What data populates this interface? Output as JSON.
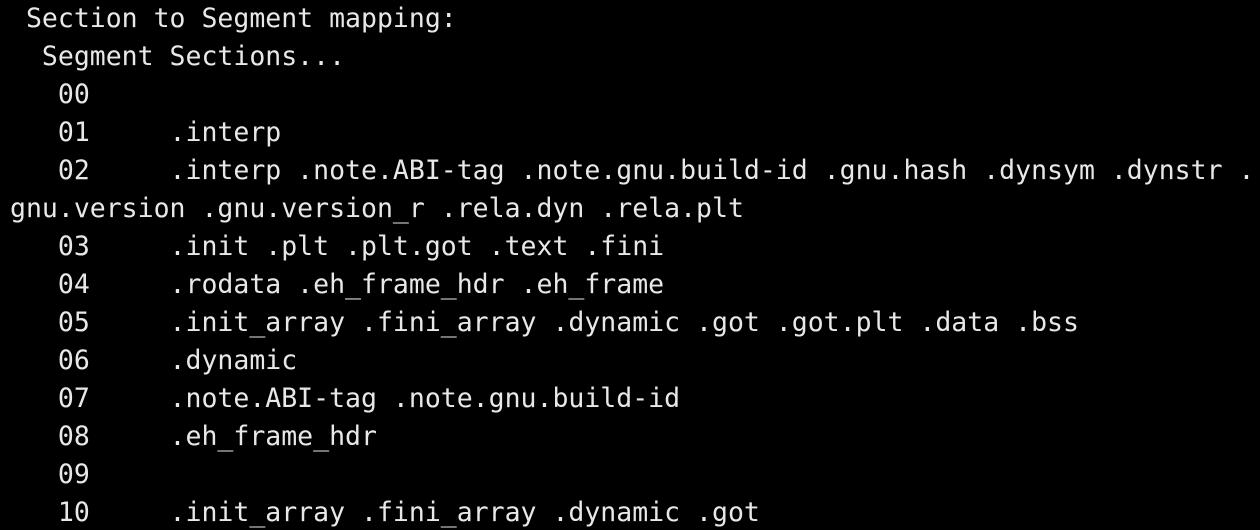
{
  "colors": {
    "background": "#000000",
    "text": "#e8e8e8"
  },
  "terminal": {
    "lines": [
      " Section to Segment mapping:",
      "  Segment Sections...",
      "   00     ",
      "   01     .interp ",
      "   02     .interp .note.ABI-tag .note.gnu.build-id .gnu.hash .dynsym .dynstr .",
      "gnu.version .gnu.version_r .rela.dyn .rela.plt ",
      "   03     .init .plt .plt.got .text .fini ",
      "   04     .rodata .eh_frame_hdr .eh_frame ",
      "   05     .init_array .fini_array .dynamic .got .got.plt .data .bss ",
      "   06     .dynamic ",
      "   07     .note.ABI-tag .note.gnu.build-id ",
      "   08     .eh_frame_hdr ",
      "   09     ",
      "   10     .init_array .fini_array .dynamic .got "
    ]
  }
}
